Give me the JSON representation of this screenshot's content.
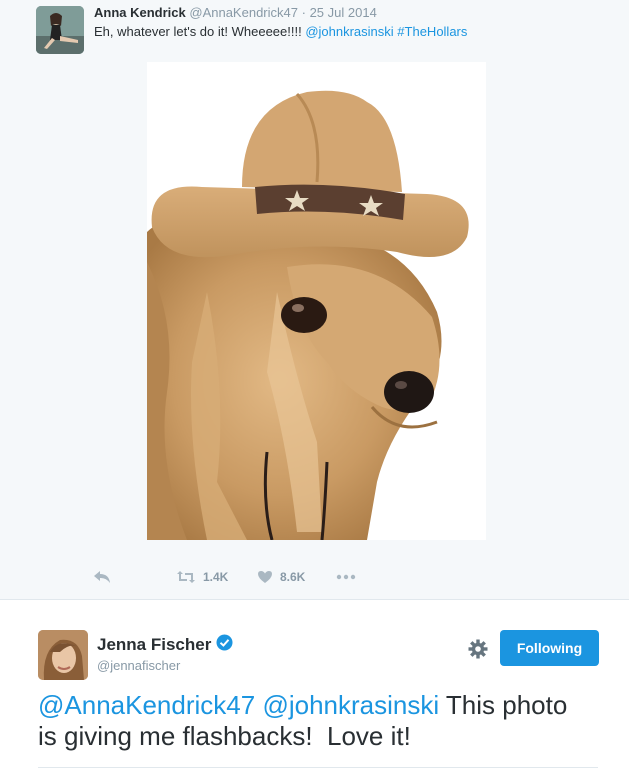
{
  "quoted_tweet": {
    "author_name": "Anna Kendrick",
    "author_handle": "@AnnaKendrick47",
    "separator": "·",
    "date": "25 Jul 2014",
    "text_prefix": "Eh, whatever let's do it! Wheeeee!!!! ",
    "mention": "@johnkrasinski",
    "hashtag": "#TheHollars",
    "media_icon": "dog-in-cowboy-hat-photo",
    "actions": {
      "reply_icon": "reply-icon",
      "retweet_count": "1.4K",
      "like_count": "8.6K",
      "more_icon": "more-icon"
    }
  },
  "main_tweet": {
    "author_name": "Jenna Fischer",
    "author_handle": "@jennafischer",
    "verified": true,
    "follow_label": "Following",
    "mention_1": "@AnnaKendrick47",
    "mention_2": "@johnkrasinski",
    "text_line_1_rest": "This photo",
    "text_line_2": "is giving me flashbacks!  Love it!"
  },
  "colors": {
    "accent": "#1b95e0",
    "muted": "#8899a6",
    "text": "#292f33",
    "quoted_background": "#f5f8fa"
  }
}
